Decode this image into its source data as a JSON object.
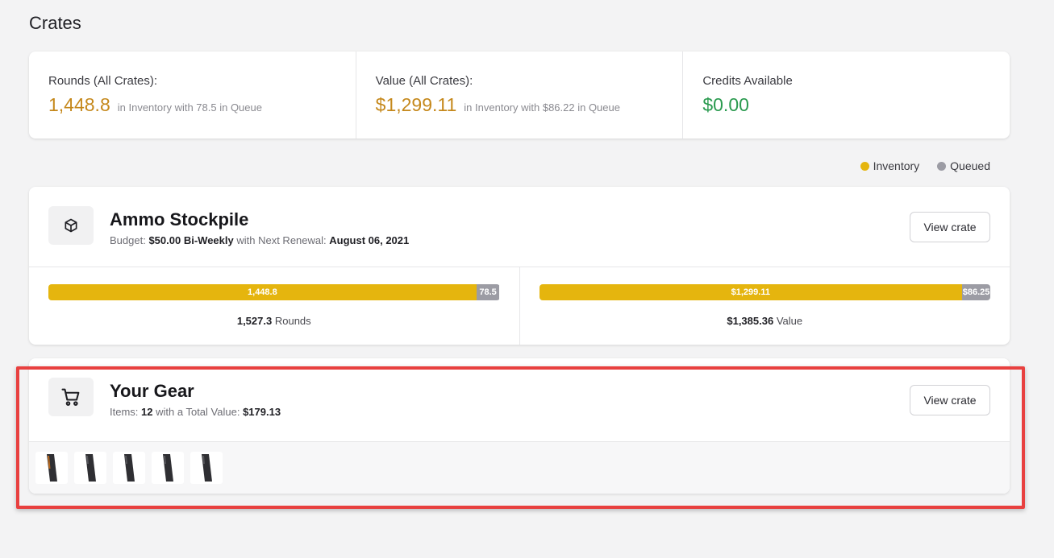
{
  "page": {
    "title": "Crates"
  },
  "stats": [
    {
      "label": "Rounds (All Crates):",
      "value": "1,448.8",
      "sub": "in Inventory with 78.5 in Queue",
      "color": "#c5881b"
    },
    {
      "label": "Value (All Crates):",
      "value": "$1,299.11",
      "sub": "in Inventory with $86.22 in Queue",
      "color": "#c5881b"
    },
    {
      "label": "Credits Available",
      "value": "$0.00",
      "sub": "",
      "color": "#2a9a4f"
    }
  ],
  "legend": [
    {
      "label": "Inventory",
      "color": "#e5b50e"
    },
    {
      "label": "Queued",
      "color": "#9c9ca4"
    }
  ],
  "crates": {
    "ammo": {
      "name": "Ammo Stockpile",
      "budget_label": "Budget:",
      "budget_value": "$50.00 Bi-Weekly",
      "renewal_label": "with Next Renewal:",
      "renewal_value": "August 06, 2021",
      "button_label": "View crate",
      "rounds_bar": {
        "inventory_label": "1,448.8",
        "queue_label": "78.5",
        "inventory_fraction": 0.9486
      },
      "rounds_caption_value": "1,527.3",
      "rounds_caption_unit": "Rounds",
      "value_bar": {
        "inventory_label": "$1,299.11",
        "queue_label": "$86.25",
        "inventory_fraction": 0.9377
      },
      "value_caption_value": "$1,385.36",
      "value_caption_unit": "Value"
    },
    "gear": {
      "name": "Your Gear",
      "items_label": "Items:",
      "items_value": "12",
      "total_label": "with a Total Value:",
      "total_value": "$179.13",
      "button_label": "View crate",
      "thumbnails": [
        "magazine-image",
        "magazine-image",
        "magazine-image",
        "magazine-image",
        "magazine-image"
      ]
    }
  },
  "colors": {
    "accent_gold": "#c5881b",
    "bar_inventory": "#e5b50e",
    "bar_queued": "#9c9ca4",
    "credits_green": "#2a9a4f",
    "highlight_red": "#e8403f"
  }
}
